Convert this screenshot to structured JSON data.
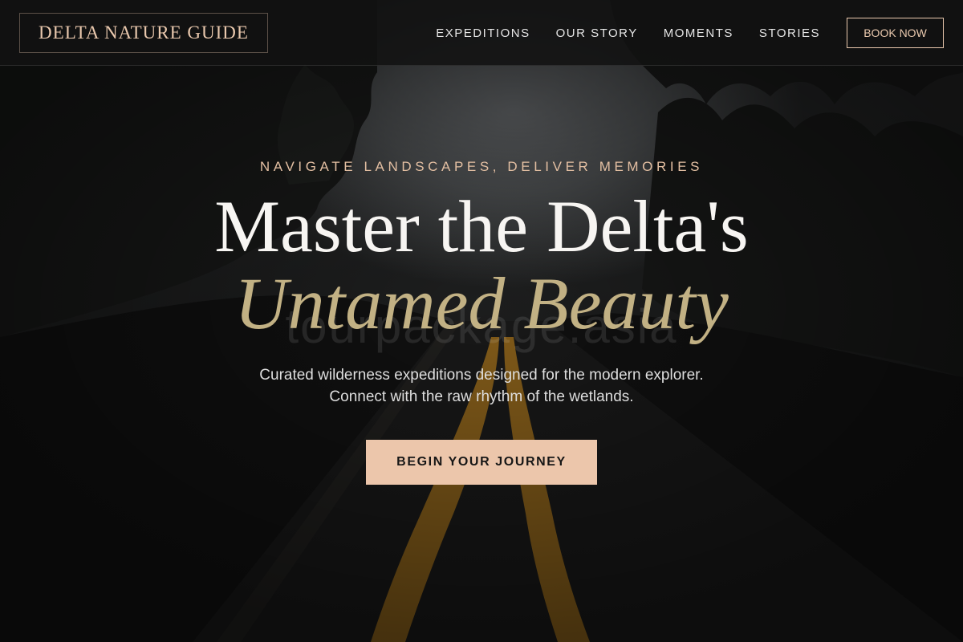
{
  "header": {
    "logo": "DELTA NATURE GUIDE",
    "nav": {
      "expeditions": "EXPEDITIONS",
      "our_story": "OUR STORY",
      "moments": "MOMENTS",
      "stories": "STORIES"
    },
    "book_now": "BOOK NOW"
  },
  "hero": {
    "tagline": "NAVIGATE LANDSCAPES, DELIVER MEMORIES",
    "headline_line1": "Master the Delta's",
    "headline_line2": "Untamed Beauty",
    "watermark": "tourpackage.asia",
    "subtitle_line1": "Curated wilderness expeditions designed for the modern explorer.",
    "subtitle_line2": "Connect with the raw rhythm of the wetlands.",
    "cta": "BEGIN YOUR JOURNEY"
  },
  "colors": {
    "accent_peach": "#ecc6ab",
    "headline_gold": "#c2b184",
    "headline_white": "#f7f5f2",
    "header_bg": "#121212"
  }
}
